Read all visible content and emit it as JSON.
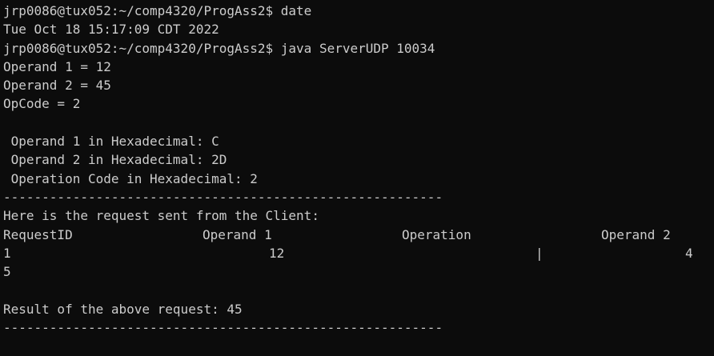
{
  "terminal": {
    "lines": [
      "jrp0086@tux052:~/comp4320/ProgAss2$ date",
      "Tue Oct 18 15:17:09 CDT 2022",
      "jrp0086@tux052:~/comp4320/ProgAss2$ java ServerUDP 10034",
      "Operand 1 = 12",
      "Operand 2 = 45",
      "OpCode = 2",
      "",
      " Operand 1 in Hexadecimal: C",
      " Operand 2 in Hexadecimal: 2D",
      " Operation Code in Hexadecimal: 2",
      "---------------------------------------------------------",
      "Here is the request sent from the Client:"
    ],
    "table": {
      "headers": [
        "RequestID",
        "Operand 1",
        "Operation",
        "Operand 2"
      ],
      "row": [
        "1",
        "12",
        "|",
        "4"
      ],
      "wrap": "5"
    },
    "tail": [
      "",
      "Result of the above request: 45",
      "---------------------------------------------------------"
    ]
  }
}
